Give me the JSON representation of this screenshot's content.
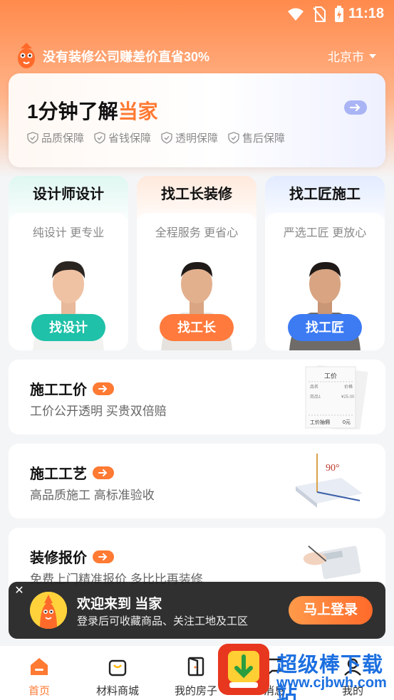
{
  "status_bar": {
    "time": "11:18"
  },
  "header": {
    "slogan": "没有装修公司赚差价直省30%",
    "city": "北京市"
  },
  "intro": {
    "title_prefix": "1分钟了解",
    "title_highlight": "当家",
    "guarantees": [
      "品质保障",
      "省钱保障",
      "透明保障",
      "售后保障"
    ]
  },
  "services": [
    {
      "title": "设计师设计",
      "subtitle": "纯设计 更专业",
      "button": "找设计",
      "color": "#1fc1a8"
    },
    {
      "title": "找工长装修",
      "subtitle": "全程服务 更省心",
      "button": "找工长",
      "color": "#ff7a3c"
    },
    {
      "title": "找工匠施工",
      "subtitle": "严选工匠 更放心",
      "button": "找工匠",
      "color": "#3d7bf3"
    }
  ],
  "info_cards": [
    {
      "title": "施工工价",
      "subtitle": "工价公开透明  买贵双倍赔",
      "receipt": {
        "header": "工价",
        "col_name": "品名",
        "col_price": "价格",
        "row_name": "商品1",
        "row_price": "¥25.00",
        "footer_label": "工价抽佣",
        "footer_value": "0元"
      }
    },
    {
      "title": "施工工艺",
      "subtitle": "高品质施工  高标准验收",
      "angle": "90°"
    },
    {
      "title": "装修报价",
      "subtitle": "免费上门精准报价  多比比再装修"
    }
  ],
  "welcome": {
    "title": "欢迎来到 当家",
    "subtitle": "登录后可收藏商品、关注工地及工区",
    "login_button": "马上登录"
  },
  "tabbar": {
    "tabs": [
      {
        "label": "首页",
        "icon": "home-icon",
        "active": true
      },
      {
        "label": "材料商城",
        "icon": "shopping-bag-icon",
        "active": false
      },
      {
        "label": "我的房子",
        "icon": "door-icon",
        "active": false
      },
      {
        "label": "消息",
        "icon": "message-icon",
        "active": false
      },
      {
        "label": "我的",
        "icon": "profile-icon",
        "active": false
      }
    ]
  },
  "watermark": {
    "text": "超级棒下载站",
    "url": "www.cjbwh.com"
  },
  "colors": {
    "accent": "#ff7a33",
    "header_bg": "#ff8a4c"
  }
}
